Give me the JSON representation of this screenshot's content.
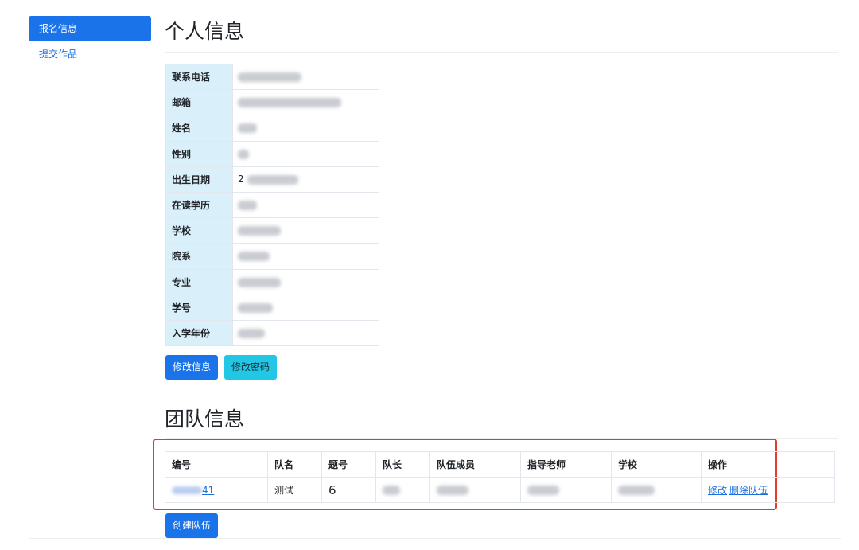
{
  "sidebar": {
    "items": [
      {
        "label": "报名信息",
        "active": true
      },
      {
        "label": "提交作品",
        "active": false
      }
    ]
  },
  "personal": {
    "title": "个人信息",
    "fields": [
      {
        "label": "联系电话"
      },
      {
        "label": "邮箱"
      },
      {
        "label": "姓名"
      },
      {
        "label": "性别"
      },
      {
        "label": "出生日期",
        "value_prefix": "2"
      },
      {
        "label": "在读学历"
      },
      {
        "label": "学校"
      },
      {
        "label": "院系"
      },
      {
        "label": "专业"
      },
      {
        "label": "学号"
      },
      {
        "label": "入学年份"
      }
    ],
    "edit_button": "修改信息",
    "password_button": "修改密码"
  },
  "team": {
    "title": "团队信息",
    "columns": [
      "编号",
      "队名",
      "题号",
      "队长",
      "队伍成员",
      "指导老师",
      "学校",
      "操作"
    ],
    "rows": [
      {
        "id_suffix": "41",
        "name": "测试",
        "problem_no": "6",
        "actions": [
          "修改",
          "删除队伍"
        ]
      }
    ],
    "create_button": "创建队伍"
  },
  "colors": {
    "primary": "#1a73e8",
    "info": "#22c7e6",
    "label_bg": "#d9f0fb",
    "highlight_border": "#e23b2e"
  }
}
